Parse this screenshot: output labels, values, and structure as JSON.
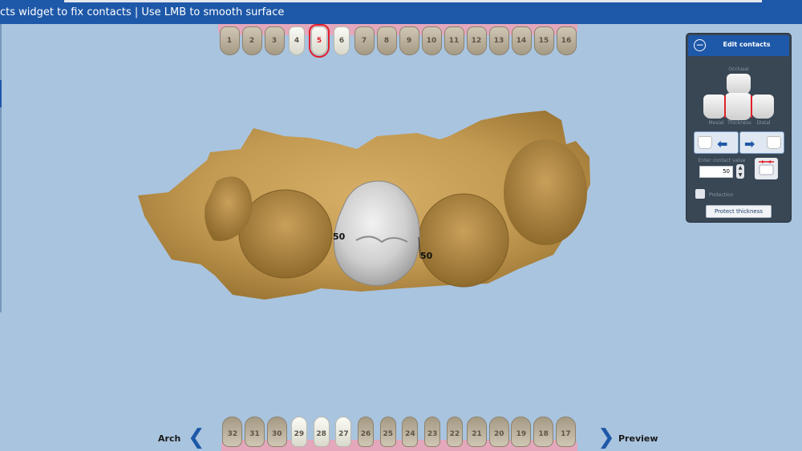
{
  "topbar": {
    "message": "cts widget to fix contacts | Use LMB to smooth surface"
  },
  "teeth_upper": [
    {
      "n": "1"
    },
    {
      "n": "2"
    },
    {
      "n": "3"
    },
    {
      "n": "4"
    },
    {
      "n": "5"
    },
    {
      "n": "6"
    },
    {
      "n": "7"
    },
    {
      "n": "8"
    },
    {
      "n": "9"
    },
    {
      "n": "10"
    },
    {
      "n": "11"
    },
    {
      "n": "12"
    },
    {
      "n": "13"
    },
    {
      "n": "14"
    },
    {
      "n": "15"
    },
    {
      "n": "16"
    }
  ],
  "teeth_lower": [
    {
      "n": "32"
    },
    {
      "n": "31"
    },
    {
      "n": "30"
    },
    {
      "n": "29"
    },
    {
      "n": "28"
    },
    {
      "n": "27"
    },
    {
      "n": "26"
    },
    {
      "n": "25"
    },
    {
      "n": "24"
    },
    {
      "n": "23"
    },
    {
      "n": "22"
    },
    {
      "n": "21"
    },
    {
      "n": "20"
    },
    {
      "n": "19"
    },
    {
      "n": "18"
    },
    {
      "n": "17"
    }
  ],
  "selected_tooth": "5",
  "nav": {
    "arch_label": "Arch",
    "preview_label": "Preview"
  },
  "contacts": {
    "mesial_value": "50",
    "distal_value": "50"
  },
  "panel": {
    "title": "Edit contacts",
    "occlusal_label": "Occlusal",
    "mesial_label": "Mesial",
    "thickness_label": "Thickness",
    "distal_label": "Distal",
    "enter_contact_label": "Enter contact value",
    "contact_value": "50",
    "protection_label": "Protection",
    "protect_button": "Protect thickness"
  },
  "colors": {
    "accent": "#1e58a8",
    "background": "#a9c4df",
    "model": "#c39a52",
    "crown": "#d7d7d7",
    "highlight": "#e0202a"
  }
}
